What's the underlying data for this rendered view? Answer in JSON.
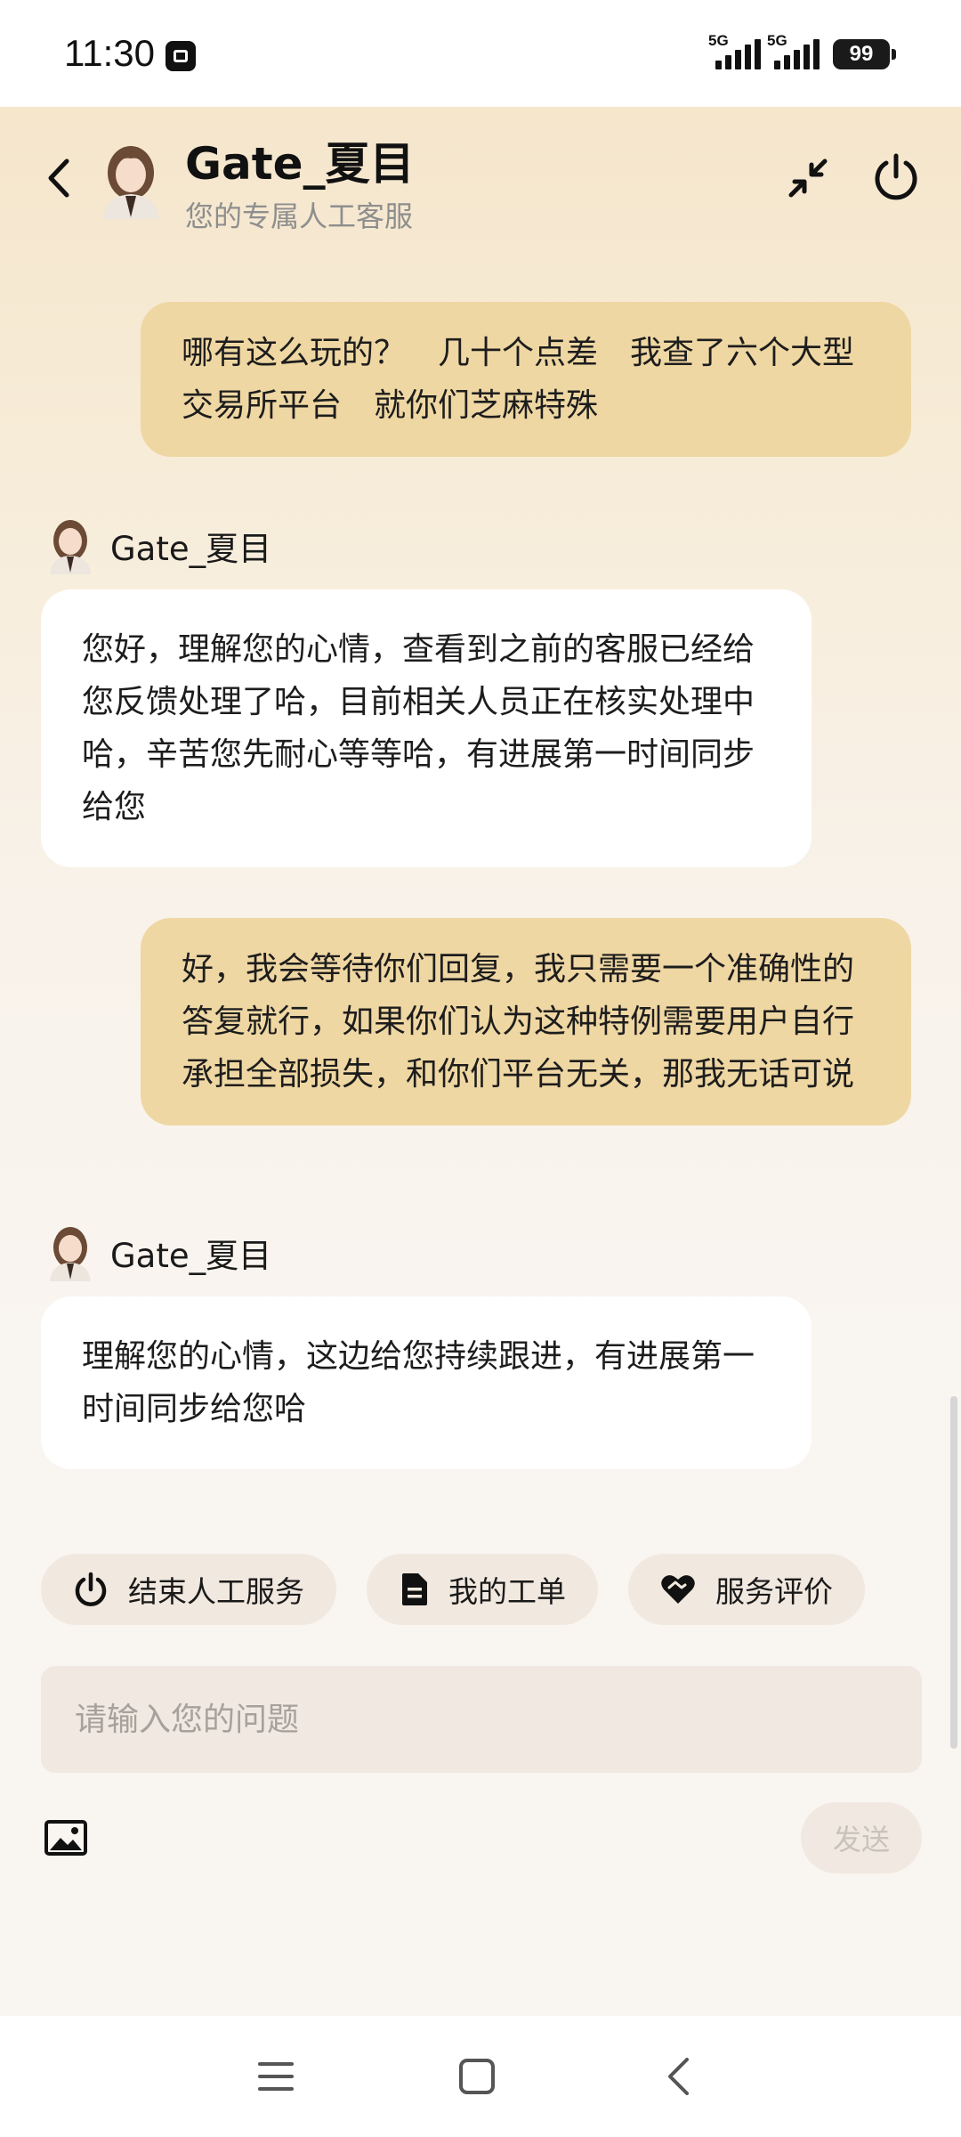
{
  "status_bar": {
    "time": "11:30",
    "signal_1_label": "5G",
    "signal_2_label": "5G",
    "battery": "99"
  },
  "header": {
    "agent_name": "Gate_夏目",
    "subtitle": "您的专属人工客服",
    "icons": [
      "back-icon",
      "minimize-icon",
      "power-icon"
    ]
  },
  "messages": [
    {
      "sender": "user",
      "text": "哪有这么玩的？　几十个点差　我查了六个大型交易所平台　就你们芝麻特殊"
    },
    {
      "sender": "agent",
      "name": "Gate_夏目",
      "text": "您好，理解您的心情，查看到之前的客服已经给您反馈处理了哈，目前相关人员正在核实处理中哈，辛苦您先耐心等等哈，有进展第一时间同步给您"
    },
    {
      "sender": "user",
      "text": "好，我会等待你们回复，我只需要一个准确性的答复就行，如果你们认为这种特例需要用户自行承担全部损失，和你们平台无关，那我无话可说"
    },
    {
      "sender": "agent",
      "name": "Gate_夏目",
      "text": "理解您的心情，这边给您持续跟进，有进展第一时间同步给您哈"
    }
  ],
  "quick_actions": [
    {
      "label": "结束人工服务",
      "icon": "power-icon"
    },
    {
      "label": "我的工单",
      "icon": "document-icon"
    },
    {
      "label": "服务评价",
      "icon": "heart-handshake-icon"
    }
  ],
  "composer": {
    "placeholder": "请输入您的问题",
    "value": "",
    "send_label": "发送",
    "image_icon": "image-icon"
  },
  "nav": {
    "icons": [
      "menu-icon",
      "home-square-icon",
      "back-chevron-icon"
    ]
  },
  "colors": {
    "user_bubble": "#efd7a3",
    "agent_bubble": "#ffffff",
    "header_bg": "#f5e6cc",
    "chip_bg": "#f1e8df"
  }
}
